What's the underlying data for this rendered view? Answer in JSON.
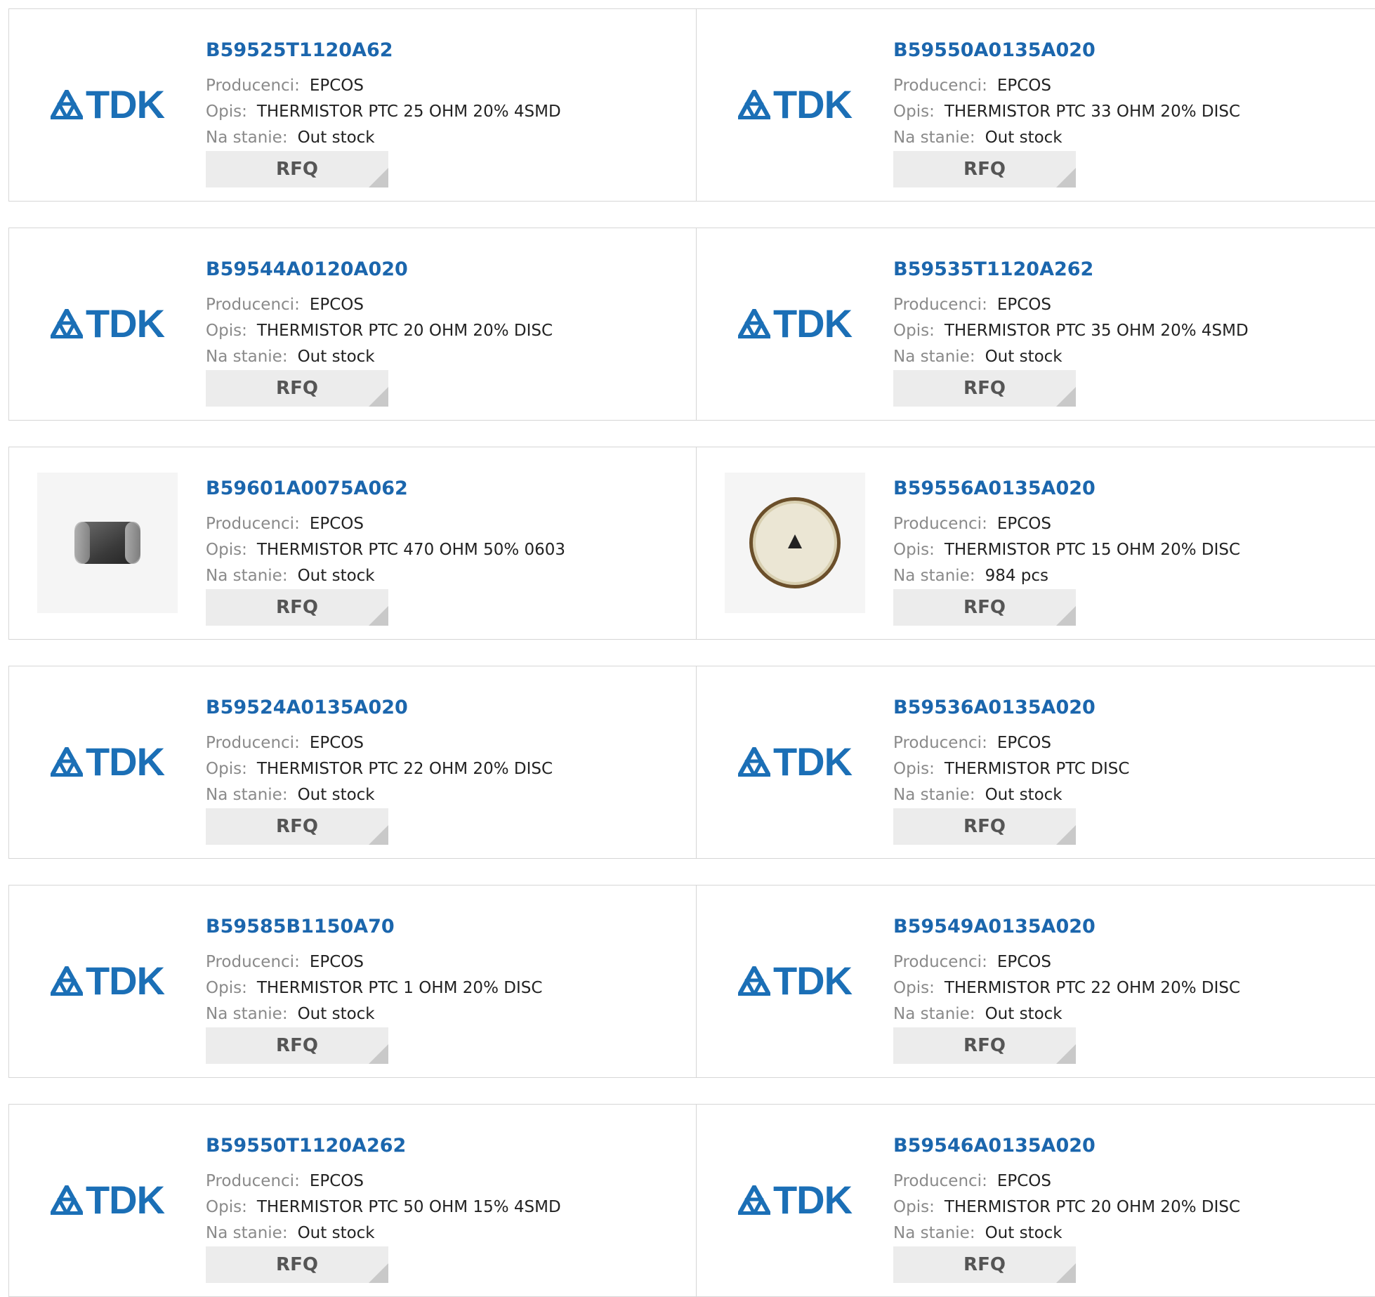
{
  "labels": {
    "manufacturer": "Producenci:",
    "description": "Opis:",
    "stock": "Na stanie:",
    "rfq": "RFQ"
  },
  "colors": {
    "title": "#1b66ad",
    "brand_logo": "#1b6fb6",
    "button_bg": "#ececec"
  },
  "products": [
    {
      "part": "B59525T1120A62",
      "manufacturer": "EPCOS",
      "description": "THERMISTOR PTC 25 OHM 20% 4SMD",
      "stock": "Out stock",
      "image": "tdk-logo"
    },
    {
      "part": "B59550A0135A020",
      "manufacturer": "EPCOS",
      "description": "THERMISTOR PTC 33 OHM 20% DISC",
      "stock": "Out stock",
      "image": "tdk-logo"
    },
    {
      "part": "B59544A0120A020",
      "manufacturer": "EPCOS",
      "description": "THERMISTOR PTC 20 OHM 20% DISC",
      "stock": "Out stock",
      "image": "tdk-logo"
    },
    {
      "part": "B59535T1120A262",
      "manufacturer": "EPCOS",
      "description": "THERMISTOR PTC 35 OHM 20% 4SMD",
      "stock": "Out stock",
      "image": "tdk-logo"
    },
    {
      "part": "B59601A0075A062",
      "manufacturer": "EPCOS",
      "description": "THERMISTOR PTC 470 OHM 50% 0603",
      "stock": "Out stock",
      "image": "smd-chip-photo"
    },
    {
      "part": "B59556A0135A020",
      "manufacturer": "EPCOS",
      "description": "THERMISTOR PTC 15 OHM 20% DISC",
      "stock": "984 pcs",
      "image": "disc-thermistor-photo"
    },
    {
      "part": "B59524A0135A020",
      "manufacturer": "EPCOS",
      "description": "THERMISTOR PTC 22 OHM 20% DISC",
      "stock": "Out stock",
      "image": "tdk-logo"
    },
    {
      "part": "B59536A0135A020",
      "manufacturer": "EPCOS",
      "description": "THERMISTOR PTC DISC",
      "stock": "Out stock",
      "image": "tdk-logo"
    },
    {
      "part": "B59585B1150A70",
      "manufacturer": "EPCOS",
      "description": "THERMISTOR PTC 1 OHM 20% DISC",
      "stock": "Out stock",
      "image": "tdk-logo"
    },
    {
      "part": "B59549A0135A020",
      "manufacturer": "EPCOS",
      "description": "THERMISTOR PTC 22 OHM 20% DISC",
      "stock": "Out stock",
      "image": "tdk-logo"
    },
    {
      "part": "B59550T1120A262",
      "manufacturer": "EPCOS",
      "description": "THERMISTOR PTC 50 OHM 15% 4SMD",
      "stock": "Out stock",
      "image": "tdk-logo"
    },
    {
      "part": "B59546A0135A020",
      "manufacturer": "EPCOS",
      "description": "THERMISTOR PTC 20 OHM 20% DISC",
      "stock": "Out stock",
      "image": "tdk-logo"
    }
  ]
}
